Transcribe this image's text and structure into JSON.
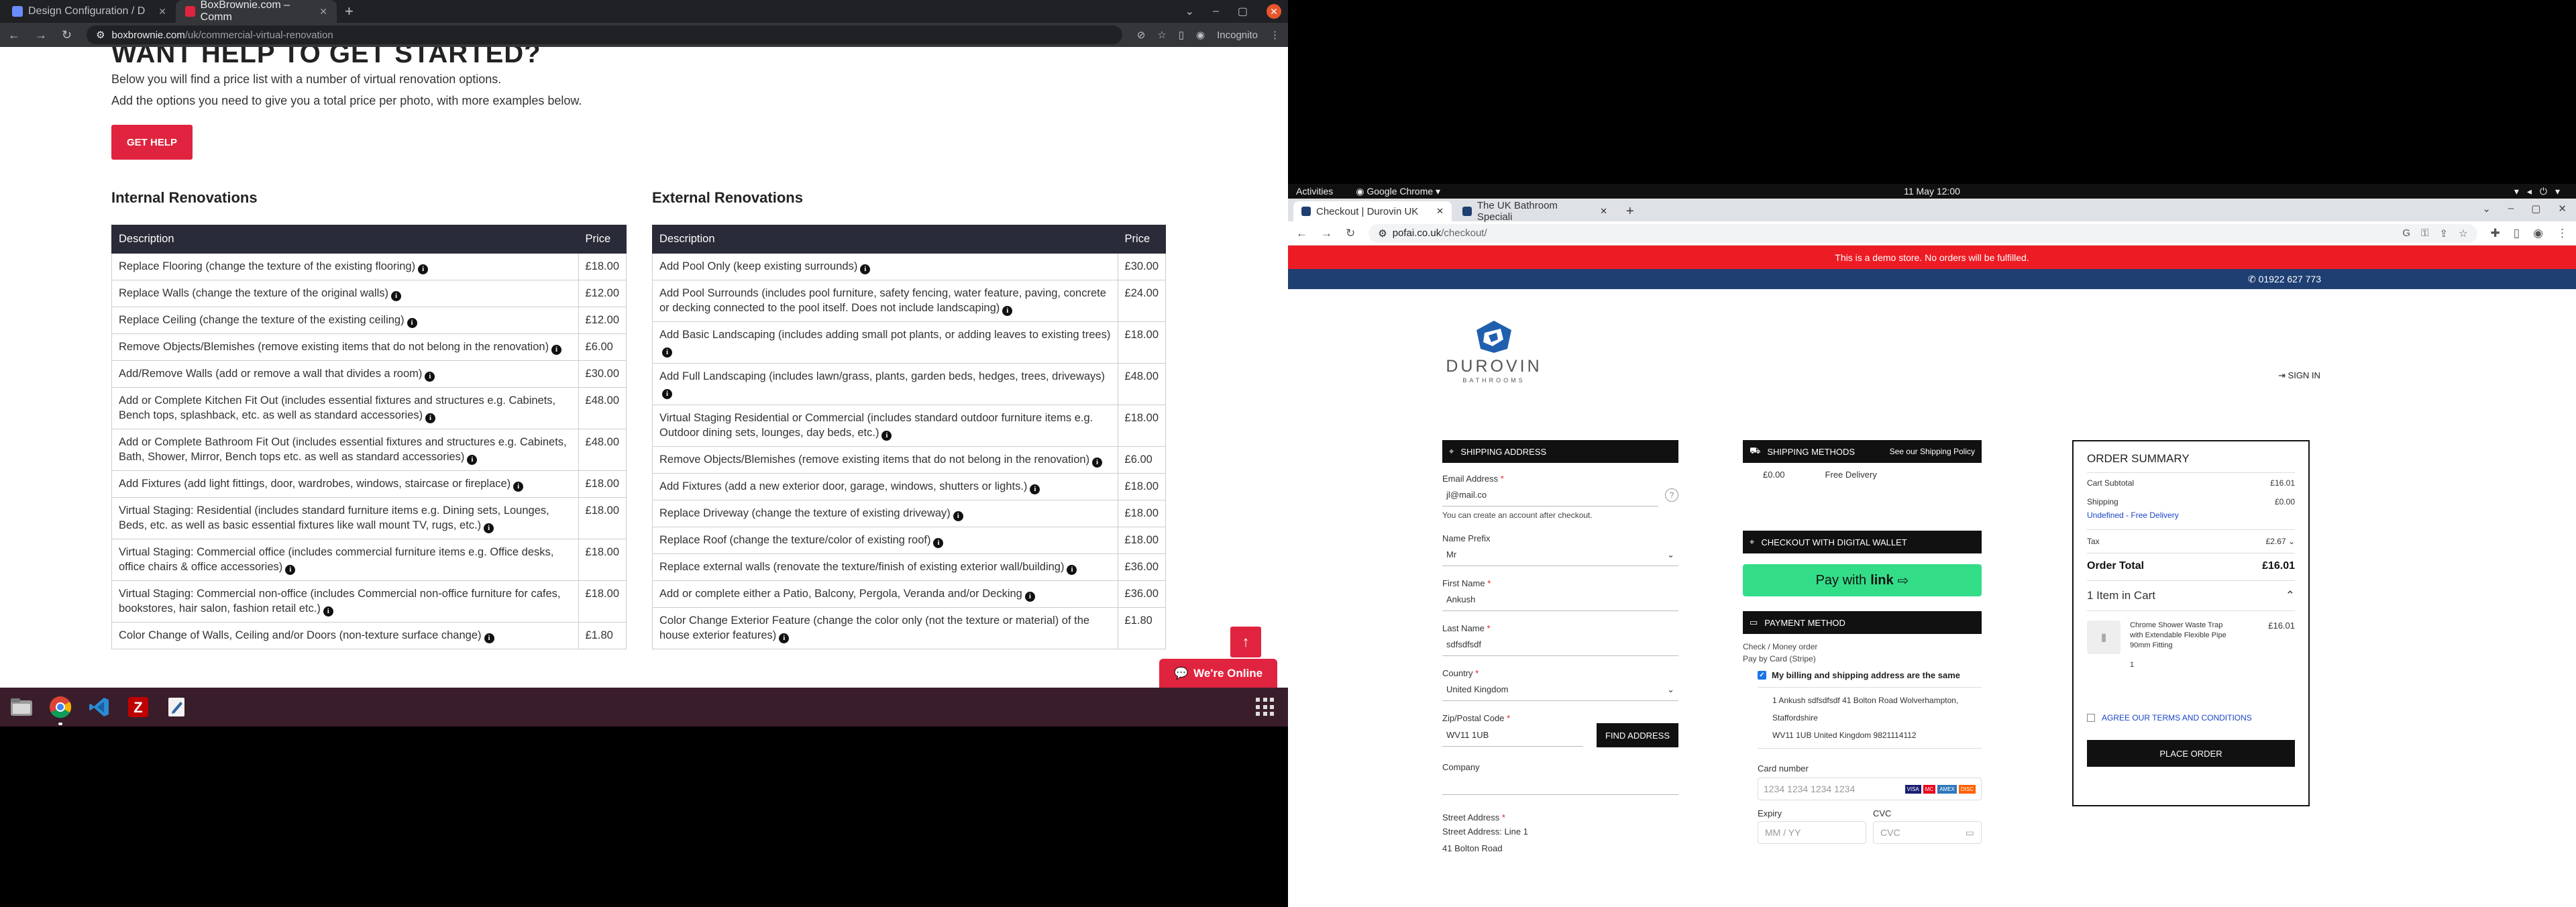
{
  "left_browser": {
    "tabs": [
      {
        "title": "Design Configuration / D",
        "active": false
      },
      {
        "title": "BoxBrownie.com – Comm",
        "active": true
      }
    ],
    "url_domain": "boxbrownie.com",
    "url_path": "/uk/commercial-virtual-renovation",
    "incognito_label": "Incognito"
  },
  "boxbrownie": {
    "hero_title": "WANT HELP TO GET STARTED?",
    "intro_line1": "Below you will find a price list with a number of virtual renovation options.",
    "intro_line2": "Add the options you need to give you a total price per photo, with more examples below.",
    "get_help_label": "GET HELP",
    "internal_title": "Internal Renovations",
    "external_title": "External Renovations",
    "col_description": "Description",
    "col_price": "Price",
    "internal_rows": [
      {
        "desc": "Replace Flooring (change the texture of the existing flooring)",
        "price": "£18.00"
      },
      {
        "desc": "Replace Walls (change the texture of the original walls)",
        "price": "£12.00"
      },
      {
        "desc": "Replace Ceiling (change the texture of the existing ceiling)",
        "price": "£12.00"
      },
      {
        "desc": "Remove Objects/Blemishes (remove existing items that do not belong in the renovation)",
        "price": "£6.00"
      },
      {
        "desc": "Add/Remove Walls (add or remove a wall that divides a room)",
        "price": "£30.00"
      },
      {
        "desc": "Add or Complete Kitchen Fit Out (includes essential fixtures and structures e.g. Cabinets, Bench tops, splashback, etc. as well as standard accessories)",
        "price": "£48.00"
      },
      {
        "desc": "Add or Complete Bathroom Fit Out (includes essential fixtures and structures e.g. Cabinets, Bath, Shower, Mirror, Bench tops etc. as well as standard accessories)",
        "price": "£48.00"
      },
      {
        "desc": "Add Fixtures (add light fittings, door, wardrobes, windows, staircase or fireplace)",
        "price": "£18.00"
      },
      {
        "desc": "Virtual Staging: Residential (includes standard furniture items e.g. Dining sets, Lounges, Beds, etc. as well as basic essential fixtures like wall mount TV, rugs, etc.)",
        "price": "£18.00"
      },
      {
        "desc": "Virtual Staging: Commercial office (includes commercial furniture items e.g. Office desks, office chairs & office accessories)",
        "price": "£18.00"
      },
      {
        "desc": "Virtual Staging: Commercial non-office (includes Commercial non-office furniture for cafes, bookstores, hair salon, fashion retail etc.)",
        "price": "£18.00"
      },
      {
        "desc": "Color Change of Walls, Ceiling and/or Doors (non-texture surface change)",
        "price": "£1.80"
      }
    ],
    "external_rows": [
      {
        "desc": "Add Pool Only (keep existing surrounds)",
        "price": "£30.00"
      },
      {
        "desc": "Add Pool Surrounds (includes pool furniture, safety fencing, water feature, paving, concrete or decking connected to the pool itself. Does not include landscaping)",
        "price": "£24.00"
      },
      {
        "desc": "Add Basic Landscaping (includes adding small pot plants, or adding leaves to existing trees)",
        "price": "£18.00"
      },
      {
        "desc": "Add Full Landscaping (includes lawn/grass, plants, garden beds, hedges, trees, driveways)",
        "price": "£48.00"
      },
      {
        "desc": "Virtual Staging Residential or Commercial (includes standard outdoor furniture items e.g. Outdoor dining sets, lounges, day beds, etc.)",
        "price": "£18.00"
      },
      {
        "desc": "Remove Objects/Blemishes (remove existing items that do not belong in the renovation)",
        "price": "£6.00"
      },
      {
        "desc": "Add Fixtures (add a new exterior door, garage, windows, shutters or lights.)",
        "price": "£18.00"
      },
      {
        "desc": "Replace Driveway (change the texture of existing driveway)",
        "price": "£18.00"
      },
      {
        "desc": "Replace Roof (change the texture/color of existing roof)",
        "price": "£18.00"
      },
      {
        "desc": "Replace external walls (renovate the texture/finish of existing exterior wall/building)",
        "price": "£36.00"
      },
      {
        "desc": "Add or complete either a Patio, Balcony, Pergola, Veranda and/or Decking",
        "price": "£36.00"
      },
      {
        "desc": "Color Change Exterior Feature (change the color only (not the texture or material) of the house exterior features)",
        "price": "£1.80"
      }
    ],
    "online_label": "We're Online"
  },
  "gnome": {
    "activities": "Activities",
    "app_name": "Google Chrome",
    "clock": "11 May  12:00"
  },
  "right_browser": {
    "tabs": [
      {
        "title": "Checkout | Durovin UK",
        "active": true
      },
      {
        "title": "The UK Bathroom Speciali",
        "active": false
      }
    ],
    "url_domain": "pofai.co.uk",
    "url_path": "/checkout/"
  },
  "checkout": {
    "demo_notice": "This is a demo store. No orders will be fulfilled.",
    "phone": "01922 627 773",
    "brand_name": "DUROVIN",
    "brand_sub": "BATHROOMS",
    "sign_in": "SIGN IN",
    "shipping_address_head": "SHIPPING ADDRESS",
    "email_label": "Email Address",
    "email_value": "jl@mail.co",
    "account_note": "You can create an account after checkout.",
    "prefix_label": "Name Prefix",
    "prefix_value": "Mr",
    "first_name_label": "First Name",
    "first_name_value": "Ankush",
    "last_name_label": "Last Name",
    "last_name_value": "sdfsdfsdf",
    "country_label": "Country",
    "country_value": "United Kingdom",
    "zip_label": "Zip/Postal Code",
    "zip_value": "WV11 1UB",
    "find_address": "FIND ADDRESS",
    "company_label": "Company",
    "street_label": "Street Address",
    "street_line1_label": "Street Address: Line 1",
    "street_line1_value": "41 Bolton Road",
    "shipping_methods_head": "SHIPPING METHODS",
    "shipping_policy": "See our Shipping Policy",
    "ship_price": "£0.00",
    "ship_name": "Free Delivery",
    "digital_wallet_head": "CHECKOUT WITH DIGITAL WALLET",
    "pay_with": "Pay with",
    "link_word": "link",
    "payment_method_head": "PAYMENT METHOD",
    "pm_check": "Check / Money order",
    "pm_card": "Pay by Card (Stripe)",
    "same_address_label": "My billing and shipping address are the same",
    "billing_line1": "1 Ankush sdfsdfsdf 41 Bolton Road Wolverhampton,",
    "billing_line2": "Staffordshire",
    "billing_line3": "WV11 1UB United Kingdom 9821114112",
    "card_number_label": "Card number",
    "card_number_placeholder": "1234 1234 1234 1234",
    "expiry_label": "Expiry",
    "expiry_placeholder": "MM / YY",
    "cvc_label": "CVC",
    "cvc_placeholder": "CVC",
    "card_brands": [
      "VISA",
      "MC",
      "AMEX",
      "DISC"
    ],
    "summary_title": "ORDER SUMMARY",
    "cart_subtotal_label": "Cart Subtotal",
    "cart_subtotal_value": "£16.01",
    "shipping_label": "Shipping",
    "shipping_value": "£0.00",
    "shipping_method_text": "Undefined - Free Delivery",
    "tax_label": "Tax",
    "tax_value": "£2.67",
    "order_total_label": "Order Total",
    "order_total_value": "£16.01",
    "items_in_cart": "1 Item in Cart",
    "item_name": "Chrome Shower Waste Trap with Extendable Flexible Pipe 90mm Fitting",
    "item_price": "£16.01",
    "item_qty": "1",
    "agree_terms": "AGREE OUR TERMS AND CONDITIONS",
    "place_order": "PLACE ORDER"
  },
  "colors": {
    "boxbrownie_red": "#e0243f",
    "table_header": "#2a2b38",
    "demo_red": "#ed1c24",
    "navy": "#1f3f72",
    "link_green": "#33dd88",
    "taskbar": "#3a1d2a"
  }
}
